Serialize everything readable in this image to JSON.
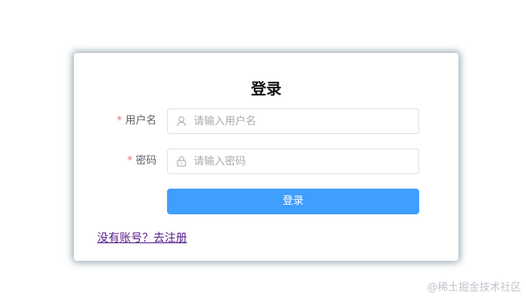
{
  "login": {
    "title": "登录",
    "username": {
      "label": "用户名",
      "required_mark": "*",
      "placeholder": "请输入用户名",
      "icon": "user-icon"
    },
    "password": {
      "label": "密码",
      "required_mark": "*",
      "placeholder": "请输入密码",
      "icon": "lock-icon"
    },
    "submit_label": "登录",
    "register_link": "没有账号？去注册"
  },
  "watermark": "@稀土掘金技术社区",
  "colors": {
    "primary": "#409eff",
    "required": "#f56c6c",
    "link": "#551a8b"
  }
}
